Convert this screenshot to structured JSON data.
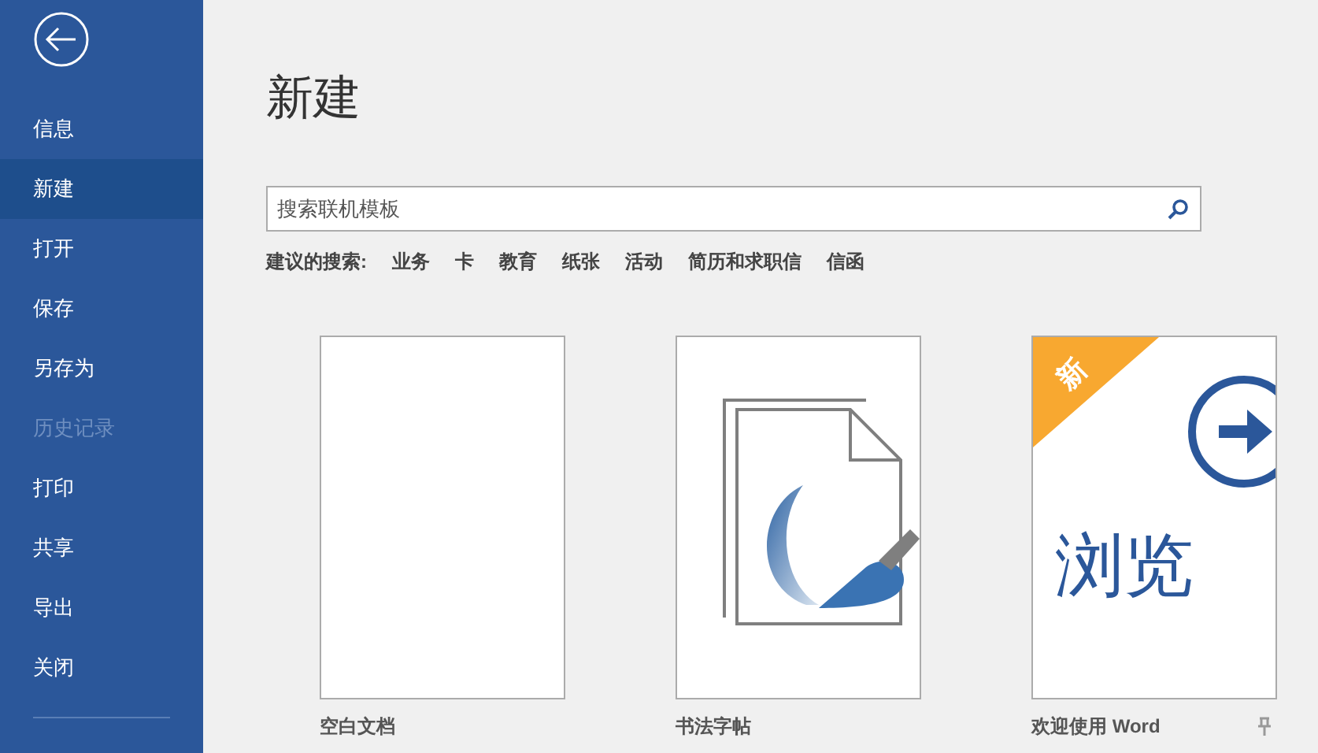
{
  "sidebar": {
    "items": [
      {
        "label": "信息",
        "selected": false,
        "disabled": false
      },
      {
        "label": "新建",
        "selected": true,
        "disabled": false
      },
      {
        "label": "打开",
        "selected": false,
        "disabled": false
      },
      {
        "label": "保存",
        "selected": false,
        "disabled": false
      },
      {
        "label": "另存为",
        "selected": false,
        "disabled": false
      },
      {
        "label": "历史记录",
        "selected": false,
        "disabled": true
      },
      {
        "label": "打印",
        "selected": false,
        "disabled": false
      },
      {
        "label": "共享",
        "selected": false,
        "disabled": false
      },
      {
        "label": "导出",
        "selected": false,
        "disabled": false
      },
      {
        "label": "关闭",
        "selected": false,
        "disabled": false
      }
    ]
  },
  "page": {
    "title": "新建"
  },
  "search": {
    "placeholder": "搜索联机模板"
  },
  "suggested": {
    "label": "建议的搜索:",
    "terms": [
      "业务",
      "卡",
      "教育",
      "纸张",
      "活动",
      "简历和求职信",
      "信函"
    ]
  },
  "templates": [
    {
      "kind": "blank",
      "name": "空白文档"
    },
    {
      "kind": "calligraphy",
      "name": "书法字帖"
    },
    {
      "kind": "tour",
      "name": "欢迎使用 Word",
      "badge": "新",
      "title": "浏览",
      "pinned": true
    }
  ]
}
